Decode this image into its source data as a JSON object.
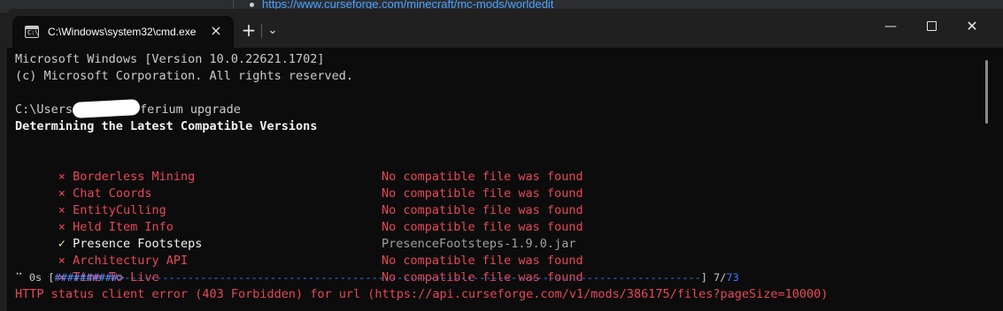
{
  "background": {
    "link_text": "https://www.curseforge.com/minecraft/mc-mods/worldedit"
  },
  "window": {
    "tab_title": "C:\\Windows\\system32\\cmd.exe",
    "tab_icon": "cmd-icon",
    "tab_close": "×",
    "new_tab": "+",
    "dropdown": "⌄",
    "minimize": "—",
    "close": "✕"
  },
  "terminal": {
    "header_line1": "Microsoft Windows [Version 10.0.22621.1702]",
    "header_line2": "(c) Microsoft Corporation. All rights reserved.",
    "prompt_prefix": "C:\\Users",
    "prompt_suffix": "ferium upgrade",
    "status_heading": "Determining the Latest Compatible Versions",
    "results": [
      {
        "mark": "×",
        "name": "Borderless Mining",
        "result": "No compatible file was found",
        "ok": false
      },
      {
        "mark": "×",
        "name": "Chat Coords",
        "result": "No compatible file was found",
        "ok": false
      },
      {
        "mark": "×",
        "name": "EntityCulling",
        "result": "No compatible file was found",
        "ok": false
      },
      {
        "mark": "×",
        "name": "Held Item Info",
        "result": "No compatible file was found",
        "ok": false
      },
      {
        "mark": "✓",
        "name": "Presence Footsteps",
        "result": "PresenceFootsteps-1.9.0.jar",
        "ok": true
      },
      {
        "mark": "×",
        "name": "Architectury API",
        "result": "No compatible file was found",
        "ok": false
      },
      {
        "mark": "×",
        "name": "Time To Live",
        "result": "No compatible file was found",
        "ok": false
      }
    ],
    "progress": {
      "spinner": "⠉",
      "elapsed": "0s",
      "filled": "##########>",
      "remaining": "-------------------------------------------------------------------------------------------",
      "done": "7",
      "total": "73"
    },
    "error": "HTTP status client error (403 Forbidden) for url (https://api.curseforge.com/v1/mods/386175/files?pageSize=10000)"
  },
  "colors": {
    "error_red": "#e74856",
    "ok_yellow": "#f9f1a5",
    "progress_blue": "#3b78ff",
    "background": "#0c0c0c"
  }
}
